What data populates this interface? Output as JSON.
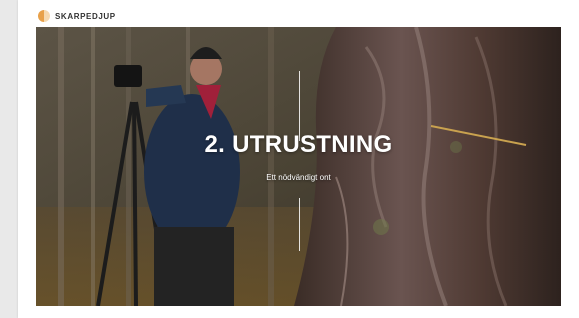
{
  "header": {
    "logo_icon": "skarpedjup-logo-icon",
    "brand": "SKARPEDJUP"
  },
  "hero": {
    "title": "2. UTRUSTNING",
    "subtitle": "Ett nödvändigt ont"
  },
  "colors": {
    "logo_accent": "#e8a14a",
    "title_text": "#ffffff"
  }
}
